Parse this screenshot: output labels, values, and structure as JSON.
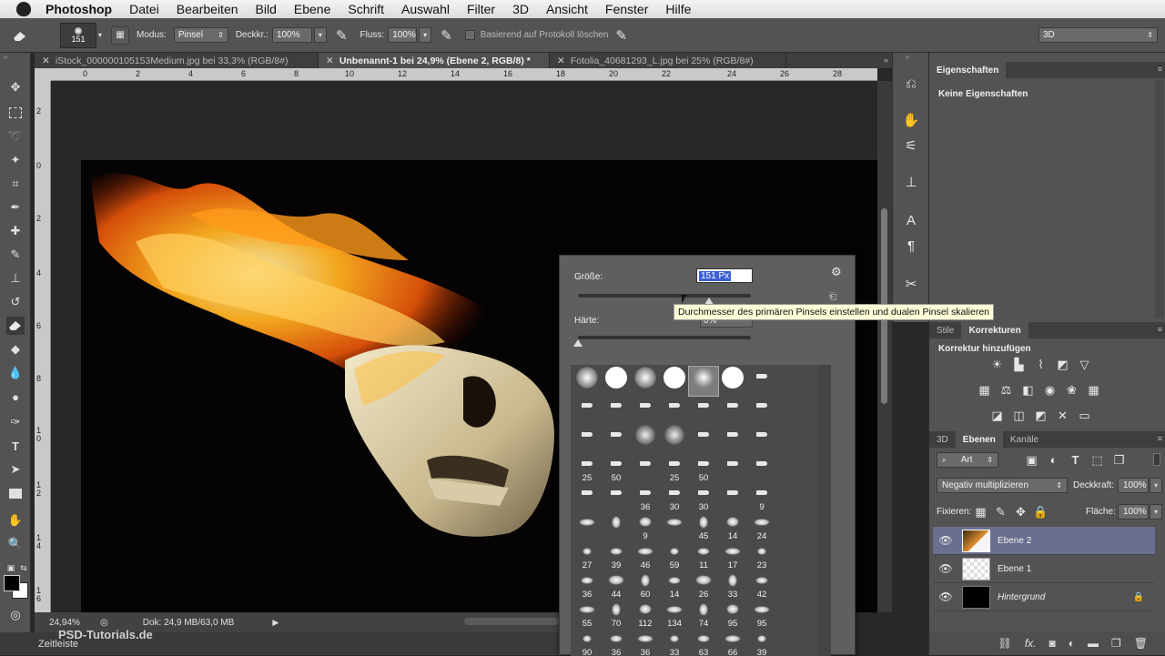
{
  "menubar": {
    "app": "Photoshop",
    "items": [
      "Datei",
      "Bearbeiten",
      "Bild",
      "Ebene",
      "Schrift",
      "Auswahl",
      "Filter",
      "3D",
      "Ansicht",
      "Fenster",
      "Hilfe"
    ]
  },
  "options": {
    "brush_size": "151",
    "modus_label": "Modus:",
    "modus_value": "Pinsel",
    "deckkr_label": "Deckkr.:",
    "deckkr_value": "100%",
    "fluss_label": "Fluss:",
    "fluss_value": "100%",
    "protokoll_label": "Basierend auf Protokoll löschen",
    "workspace": "3D"
  },
  "tabs": [
    {
      "label": "iStock_000000105153Medium.jpg bei 33,3% (RGB/8#)"
    },
    {
      "label": "Unbenannt-1 bei 24,9% (Ebene 2, RGB/8) *"
    },
    {
      "label": "Fotolia_40681293_L.jpg bei 25% (RGB/8#)"
    }
  ],
  "ruler_top": [
    "0",
    "2",
    "4",
    "6",
    "8",
    "10",
    "12",
    "14",
    "16",
    "18",
    "20",
    "22",
    "24",
    "26",
    "28"
  ],
  "ruler_left": [
    "2",
    "0",
    "2",
    "4",
    "6",
    "8",
    "1\n0",
    "1\n2",
    "1\n4",
    "1\n6"
  ],
  "status": {
    "zoom": "24,94%",
    "doc": "Dok: 24,9 MB/63,0 MB"
  },
  "timeline": {
    "label": "Zeitleiste",
    "watermark": "PSD-Tutorials.de"
  },
  "brush_popup": {
    "size_label": "Größe:",
    "size_value": "151 Px",
    "hardness_label": "Härte:",
    "hardness_value": "0%",
    "size_fraction": 0.76,
    "hardness_fraction": 0.0
  },
  "tooltip": "Durchmesser des primären Pinsels einstellen und dualen Pinsel skalieren",
  "brush_numbers": [
    [
      "",
      "",
      "",
      "",
      "",
      "",
      ""
    ],
    [
      "",
      "",
      "",
      "",
      "",
      "",
      ""
    ],
    [
      "",
      "",
      "",
      "",
      "",
      "",
      ""
    ],
    [
      "25",
      "50",
      "",
      "25",
      "50",
      "",
      ""
    ],
    [
      "",
      "",
      "36",
      "30",
      "30",
      "",
      "9"
    ],
    [
      "",
      "",
      "9",
      "",
      "45",
      "14",
      "24"
    ],
    [
      "27",
      "39",
      "46",
      "59",
      "11",
      "17",
      "23"
    ],
    [
      "36",
      "44",
      "60",
      "14",
      "26",
      "33",
      "42"
    ],
    [
      "55",
      "70",
      "112",
      "134",
      "74",
      "95",
      "95"
    ],
    [
      "90",
      "36",
      "36",
      "33",
      "63",
      "66",
      "39"
    ]
  ],
  "properties": {
    "tab": "Eigenschaften",
    "empty": "Keine Eigenschaften"
  },
  "adjustments": {
    "tab_styles": "Stile",
    "tab_corrections": "Korrekturen",
    "heading": "Korrektur hinzufügen"
  },
  "layers": {
    "tab_3d": "3D",
    "tab_layers": "Ebenen",
    "tab_channels": "Kanäle",
    "filter": "Art",
    "blend_mode": "Negativ multiplizieren",
    "opacity_label": "Deckkraft:",
    "opacity_value": "100%",
    "lock_label": "Fixieren:",
    "fill_label": "Fläche:",
    "fill_value": "100%",
    "items": [
      {
        "name": "Ebene 2"
      },
      {
        "name": "Ebene 1"
      },
      {
        "name": "Hintergrund"
      }
    ]
  },
  "colors": {
    "accent_selected_layer": "#6b6f8f",
    "tooltip_bg": "#fffcd6"
  }
}
